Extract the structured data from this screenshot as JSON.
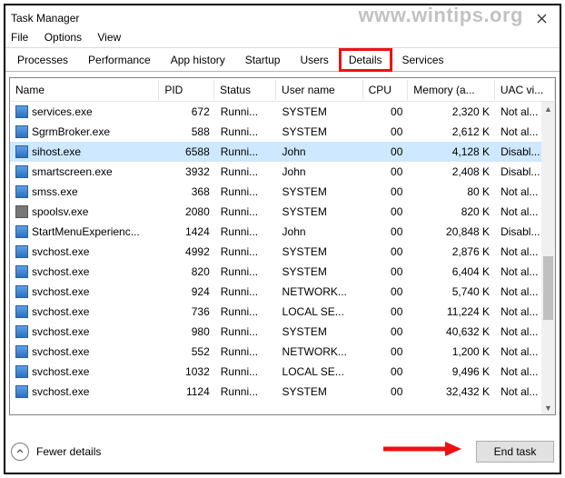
{
  "window": {
    "title": "Task Manager"
  },
  "watermark": "www.wintips.org",
  "menu": {
    "file": "File",
    "options": "Options",
    "view": "View"
  },
  "tabs": {
    "processes": "Processes",
    "performance": "Performance",
    "apphistory": "App history",
    "startup": "Startup",
    "users": "Users",
    "details": "Details",
    "services": "Services"
  },
  "columns": {
    "name": "Name",
    "pid": "PID",
    "status": "Status",
    "user": "User name",
    "cpu": "CPU",
    "mem": "Memory (a...",
    "uac": "UAC vi..."
  },
  "rows": [
    {
      "icon": "app",
      "name": "services.exe",
      "pid": "672",
      "status": "Runni...",
      "user": "SYSTEM",
      "cpu": "00",
      "mem": "2,320 K",
      "uac": "Not al..."
    },
    {
      "icon": "app",
      "name": "SgrmBroker.exe",
      "pid": "588",
      "status": "Runni...",
      "user": "SYSTEM",
      "cpu": "00",
      "mem": "2,612 K",
      "uac": "Not al..."
    },
    {
      "icon": "app",
      "name": "sihost.exe",
      "pid": "6588",
      "status": "Runni...",
      "user": "John",
      "cpu": "00",
      "mem": "4,128 K",
      "uac": "Disabl...",
      "selected": true
    },
    {
      "icon": "app",
      "name": "smartscreen.exe",
      "pid": "3932",
      "status": "Runni...",
      "user": "John",
      "cpu": "00",
      "mem": "2,408 K",
      "uac": "Disabl..."
    },
    {
      "icon": "app",
      "name": "smss.exe",
      "pid": "368",
      "status": "Runni...",
      "user": "SYSTEM",
      "cpu": "00",
      "mem": "80 K",
      "uac": "Not al..."
    },
    {
      "icon": "printer",
      "name": "spoolsv.exe",
      "pid": "2080",
      "status": "Runni...",
      "user": "SYSTEM",
      "cpu": "00",
      "mem": "820 K",
      "uac": "Not al..."
    },
    {
      "icon": "app",
      "name": "StartMenuExperienc...",
      "pid": "1424",
      "status": "Runni...",
      "user": "John",
      "cpu": "00",
      "mem": "20,848 K",
      "uac": "Disabl..."
    },
    {
      "icon": "app",
      "name": "svchost.exe",
      "pid": "4992",
      "status": "Runni...",
      "user": "SYSTEM",
      "cpu": "00",
      "mem": "2,876 K",
      "uac": "Not al..."
    },
    {
      "icon": "app",
      "name": "svchost.exe",
      "pid": "820",
      "status": "Runni...",
      "user": "SYSTEM",
      "cpu": "00",
      "mem": "6,404 K",
      "uac": "Not al..."
    },
    {
      "icon": "app",
      "name": "svchost.exe",
      "pid": "924",
      "status": "Runni...",
      "user": "NETWORK...",
      "cpu": "00",
      "mem": "5,740 K",
      "uac": "Not al..."
    },
    {
      "icon": "app",
      "name": "svchost.exe",
      "pid": "736",
      "status": "Runni...",
      "user": "LOCAL SE...",
      "cpu": "00",
      "mem": "11,224 K",
      "uac": "Not al..."
    },
    {
      "icon": "app",
      "name": "svchost.exe",
      "pid": "980",
      "status": "Runni...",
      "user": "SYSTEM",
      "cpu": "00",
      "mem": "40,632 K",
      "uac": "Not al..."
    },
    {
      "icon": "app",
      "name": "svchost.exe",
      "pid": "552",
      "status": "Runni...",
      "user": "NETWORK...",
      "cpu": "00",
      "mem": "1,200 K",
      "uac": "Not al..."
    },
    {
      "icon": "app",
      "name": "svchost.exe",
      "pid": "1032",
      "status": "Runni...",
      "user": "LOCAL SE...",
      "cpu": "00",
      "mem": "9,496 K",
      "uac": "Not al..."
    },
    {
      "icon": "app",
      "name": "svchost.exe",
      "pid": "1124",
      "status": "Runni...",
      "user": "SYSTEM",
      "cpu": "00",
      "mem": "32,432 K",
      "uac": "Not al..."
    }
  ],
  "footer": {
    "fewer": "Fewer details",
    "endtask": "End task"
  }
}
